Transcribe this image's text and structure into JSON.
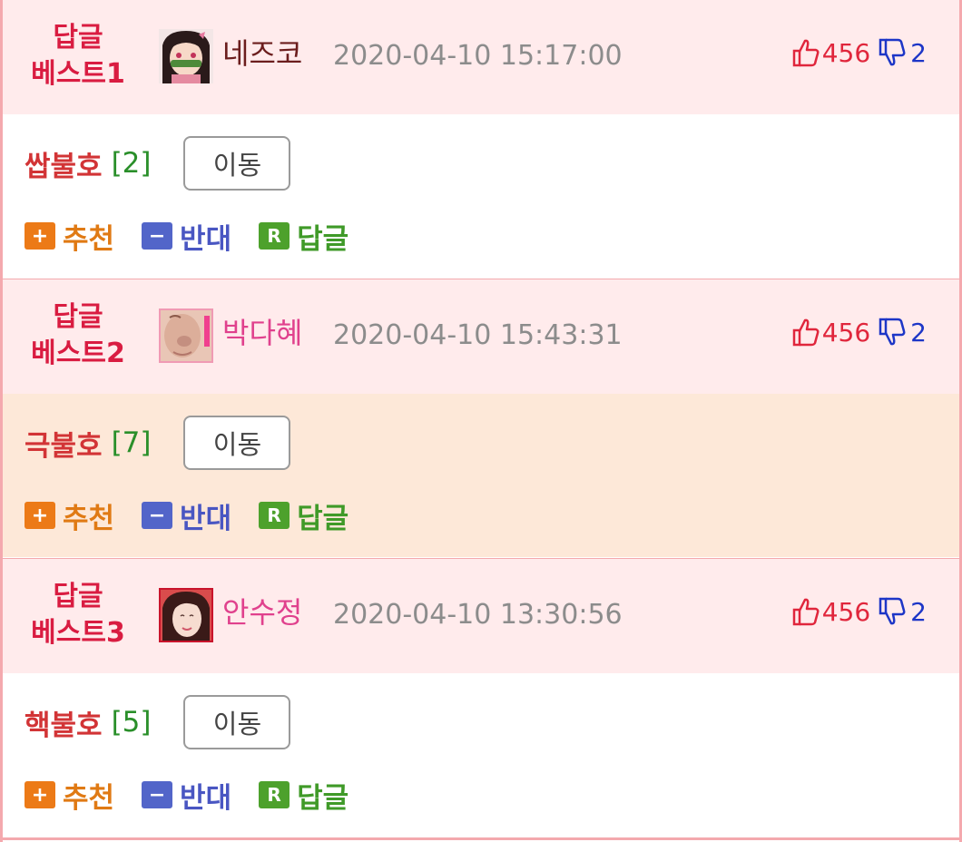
{
  "colors": {
    "border": "#f4a9ae",
    "header_bg": "#ffebec",
    "alt_body_bg": "#fde8d8",
    "rank": "#d91c41",
    "up_count": "#e0263c",
    "down_count": "#1d36c7"
  },
  "actions": {
    "recommend_label": "추천",
    "oppose_label": "반대",
    "reply_label": "답글",
    "plus_glyph": "+",
    "minus_glyph": "−",
    "reply_glyph": "R"
  },
  "posts": [
    {
      "rank_line1": "답글",
      "rank_line2": "베스트1",
      "nickname": "네즈코",
      "date": "2020-04-10 15:17:00",
      "upvotes": "456",
      "downvotes": "2",
      "title": "쌉불호",
      "count": "[2]",
      "move_label": "이동",
      "avatar_icon": "nezuko-avatar"
    },
    {
      "rank_line1": "답글",
      "rank_line2": "베스트2",
      "nickname": "박다혜",
      "date": "2020-04-10 15:43:31",
      "upvotes": "456",
      "downvotes": "2",
      "title": "극불호",
      "count": "[7]",
      "move_label": "이동",
      "avatar_icon": "face-closeup-avatar"
    },
    {
      "rank_line1": "답글",
      "rank_line2": "베스트3",
      "nickname": "안수정",
      "date": "2020-04-10 13:30:56",
      "upvotes": "456",
      "downvotes": "2",
      "title": "핵불호",
      "count": "[5]",
      "move_label": "이동",
      "avatar_icon": "woman-portrait-avatar"
    }
  ]
}
